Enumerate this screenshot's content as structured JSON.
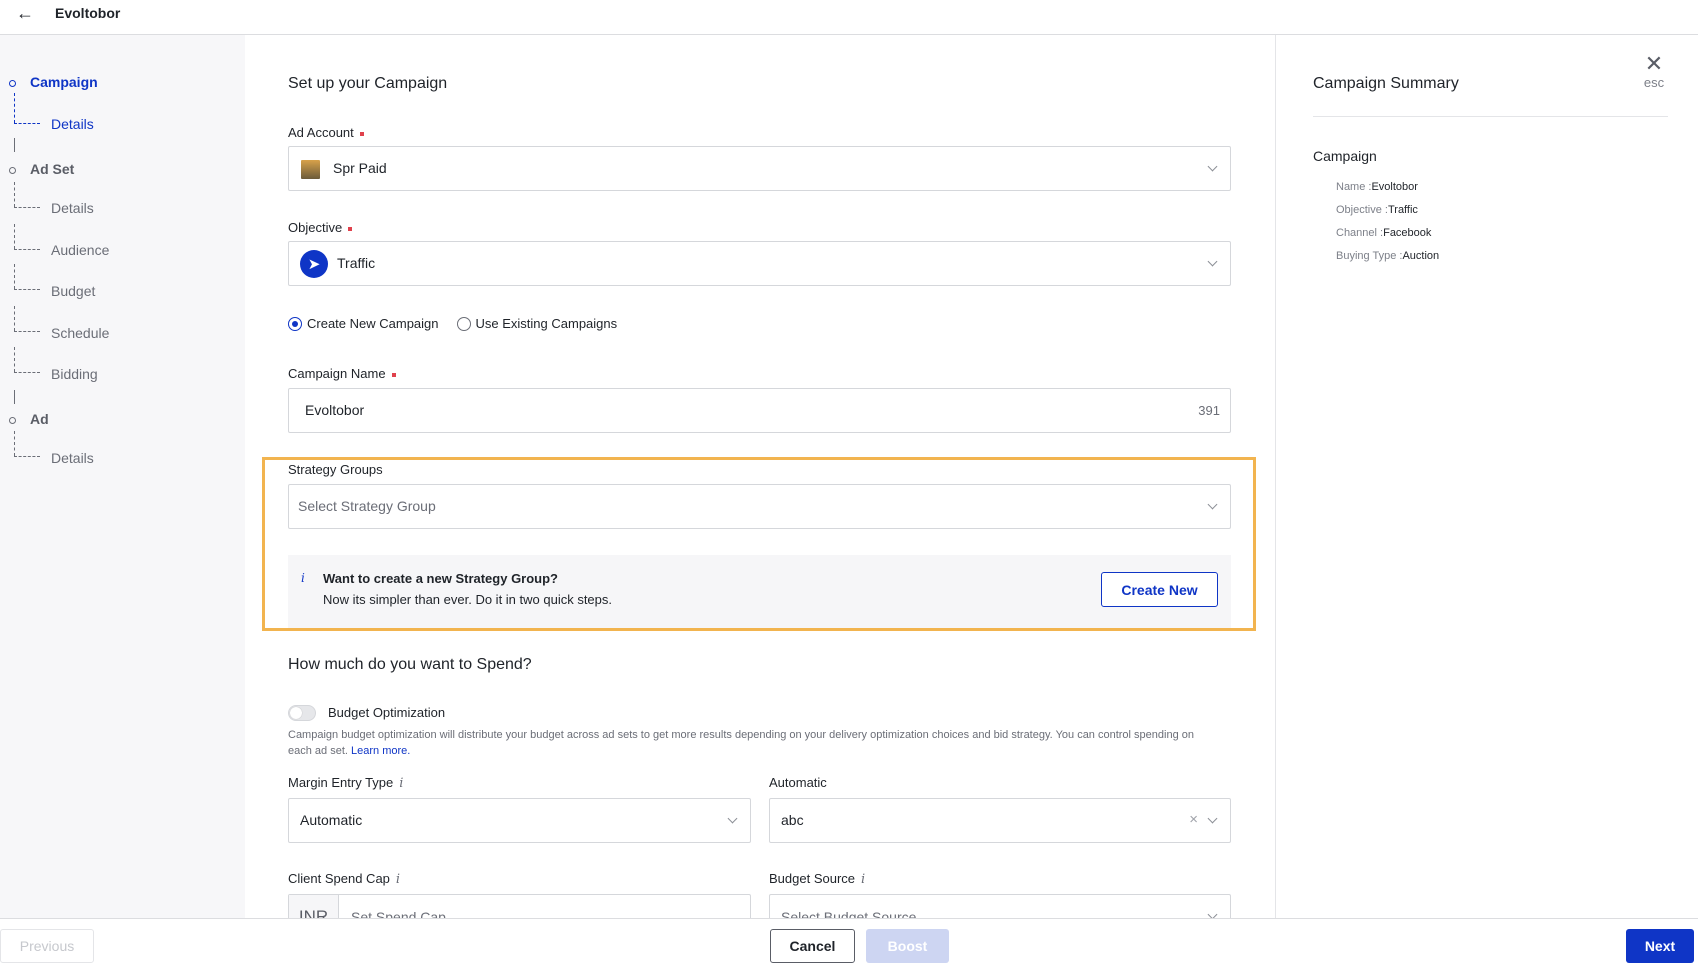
{
  "header": {
    "back_icon": "arrow-left-icon",
    "title": "Evoltobor"
  },
  "sidebar": {
    "groups": [
      {
        "label": "Campaign",
        "active": true,
        "items": [
          {
            "label": "Details",
            "active": true
          }
        ]
      },
      {
        "label": "Ad Set",
        "active": false,
        "items": [
          {
            "label": "Details"
          },
          {
            "label": "Audience"
          },
          {
            "label": "Budget"
          },
          {
            "label": "Schedule"
          },
          {
            "label": "Bidding"
          }
        ]
      },
      {
        "label": "Ad",
        "active": false,
        "items": [
          {
            "label": "Details"
          }
        ]
      }
    ]
  },
  "form": {
    "title": "Set up your Campaign",
    "ad_account": {
      "label": "Ad Account",
      "value": "Spr Paid",
      "required": true
    },
    "objective": {
      "label": "Objective",
      "value": "Traffic",
      "required": true,
      "icon": "cursor-icon"
    },
    "campaign_mode": {
      "options": [
        "Create New Campaign",
        "Use Existing Campaigns"
      ],
      "selected": "Create New Campaign"
    },
    "campaign_name": {
      "label": "Campaign Name",
      "value": "Evoltobor",
      "char_count": "391",
      "required": true
    },
    "strategy_groups": {
      "label": "Strategy Groups",
      "placeholder": "Select Strategy Group"
    },
    "strategy_info": {
      "icon": "info-icon",
      "title": "Want to create a new Strategy Group?",
      "subtitle": "Now its simpler than ever. Do it in two quick steps.",
      "button": "Create New"
    },
    "spend_title": "How much do you want to Spend?",
    "budget_optimization": {
      "label": "Budget Optimization",
      "enabled": false,
      "description": "Campaign budget optimization will distribute your budget across ad sets to get more results depending on your delivery optimization choices and bid strategy. You can control spending on each ad set.",
      "link": "Learn more."
    },
    "margin_entry_type": {
      "label": "Margin Entry Type",
      "value": "Automatic"
    },
    "automatic": {
      "label": "Automatic",
      "value": "abc"
    },
    "client_spend_cap": {
      "label": "Client Spend Cap",
      "currency": "INR",
      "placeholder": "Set Spend Cap"
    },
    "budget_source": {
      "label": "Budget Source",
      "placeholder": "Select Budget Source"
    }
  },
  "summary": {
    "title": "Campaign Summary",
    "close_label": "esc",
    "section": "Campaign",
    "rows": [
      {
        "key": "Name :",
        "value": "Evoltobor"
      },
      {
        "key": "Objective :",
        "value": "Traffic"
      },
      {
        "key": "Channel :",
        "value": "Facebook"
      },
      {
        "key": "Buying Type :",
        "value": "Auction"
      }
    ]
  },
  "footer": {
    "previous": "Previous",
    "cancel": "Cancel",
    "boost": "Boost",
    "next": "Next"
  },
  "colors": {
    "accent": "#0f35c6",
    "highlight": "#f2b44f",
    "required": "#e0414c"
  }
}
